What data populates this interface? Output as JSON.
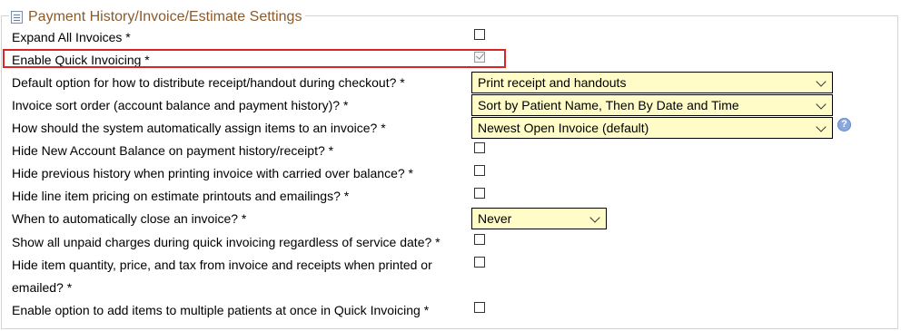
{
  "section": {
    "title": "Payment History/Invoice/Estimate Settings",
    "icon": "settings-form-icon"
  },
  "settings": [
    {
      "label": "Expand All Invoices *",
      "control": "checkbox",
      "checked": false
    },
    {
      "label": "Enable Quick Invoicing *",
      "control": "checkbox",
      "checked": true,
      "highlighted": true
    },
    {
      "label": "Default option for how to distribute receipt/handout during checkout? *",
      "control": "select",
      "value": "Print receipt and handouts"
    },
    {
      "label": "Invoice sort order (account balance and payment history)? *",
      "control": "select",
      "value": "Sort by Patient Name, Then By Date and Time"
    },
    {
      "label": "How should the system automatically assign items to an invoice? *",
      "control": "select",
      "value": "Newest Open Invoice (default)",
      "help_icon": "question-mark-icon"
    },
    {
      "label": "Hide New Account Balance on payment history/receipt? *",
      "control": "checkbox",
      "checked": false
    },
    {
      "label": "Hide previous history when printing invoice with carried over balance? *",
      "control": "checkbox",
      "checked": false
    },
    {
      "label": "Hide line item pricing on estimate printouts and emailings? *",
      "control": "checkbox",
      "checked": false
    },
    {
      "label": "When to automatically close an invoice? *",
      "control": "select",
      "value": "Never"
    },
    {
      "label": "Show all unpaid charges during quick invoicing regardless of service date? *",
      "control": "checkbox",
      "checked": false
    },
    {
      "label_line1": "Hide item quantity, price, and tax from invoice and receipts when printed or",
      "label_line2": "emailed? *",
      "control": "checkbox",
      "checked": false
    },
    {
      "label": "Enable option to add items to multiple patients at once in Quick Invoicing *",
      "control": "checkbox",
      "checked": false
    }
  ],
  "colors": {
    "select_bg": "#fffcc7",
    "legend_text": "#8b5a2b",
    "highlight_border": "#d92525"
  }
}
